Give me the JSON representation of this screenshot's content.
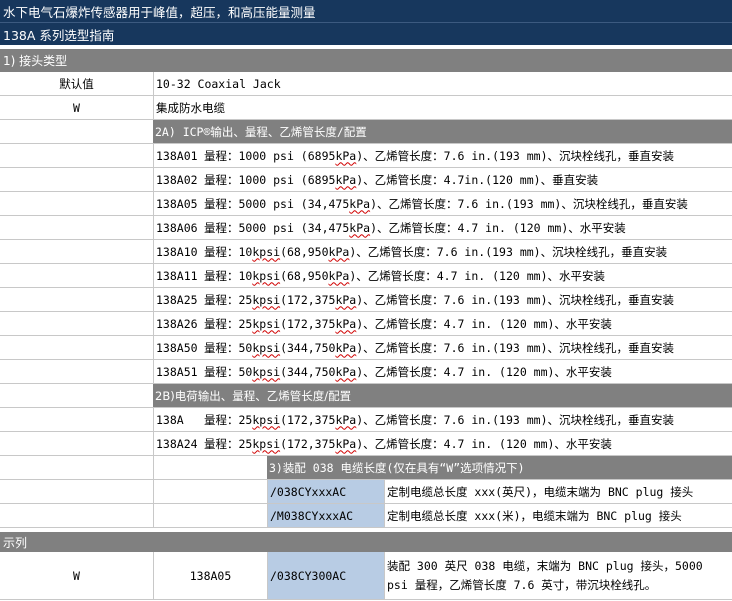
{
  "title": "水下电气石爆炸传感器用于峰值，超压，和高压能量测量",
  "subtitle": "138A 系列选型指南",
  "section1": {
    "header": "1) 接头类型",
    "rows": [
      {
        "code": "默认值",
        "desc": "10-32 Coaxial Jack"
      },
      {
        "code": "W",
        "desc": "集成防水电缆"
      }
    ]
  },
  "section2a": {
    "header": "2A) ICP®输出、量程、乙烯管长度/配置",
    "rows": [
      {
        "model": "138A01",
        "pre": "量程：1000 psi (6895 ",
        "unit": "kPa",
        "post": ")、乙烯管长度：7.6 in.(193 mm)、沉块栓线孔，垂直安装"
      },
      {
        "model": "138A02",
        "pre": "量程：1000 psi (6895 ",
        "unit": "kPa",
        "post": ")、乙烯管长度：4.7in.(120 mm)、垂直安装"
      },
      {
        "model": "138A05",
        "pre": "量程：5000 psi (34,475 ",
        "unit": "kPa",
        "post": ")、乙烯管长度：7.6 in.(193 mm)、沉块栓线孔，垂直安装"
      },
      {
        "model": "138A06",
        "pre": "量程：5000 psi (34,475 ",
        "unit": "kPa",
        "post": ")、乙烯管长度：4.7 in. (120 mm)、水平安装"
      },
      {
        "model": "138A10",
        "pre": "量程：10 ",
        "wavy1": "kpsi",
        "mid": " (68,950 ",
        "unit": "kPa",
        "post": ")、乙烯管长度：7.6 in.(193 mm)、沉块栓线孔，垂直安装"
      },
      {
        "model": "138A11",
        "pre": "量程：10 ",
        "wavy1": "kpsi",
        "mid": " (68,950 ",
        "unit": "kPa",
        "post": ")、乙烯管长度：4.7 in. (120 mm)、水平安装"
      },
      {
        "model": "138A25",
        "pre": "量程：25 ",
        "wavy1": "kpsi",
        "mid": " (172,375 ",
        "unit": "kPa",
        "post": ")、乙烯管长度：7.6 in.(193 mm)、沉块栓线孔，垂直安装"
      },
      {
        "model": "138A26",
        "pre": "量程：25 ",
        "wavy1": "kpsi",
        "mid": " (172,375 ",
        "unit": "kPa",
        "post": ")、乙烯管长度：4.7 in. (120 mm)、水平安装"
      },
      {
        "model": "138A50",
        "pre": "量程：50 ",
        "wavy1": "kpsi",
        "mid": " (344,750 ",
        "unit": "kPa",
        "post": ")、乙烯管长度：7.6 in.(193 mm)、沉块栓线孔，垂直安装"
      },
      {
        "model": "138A51",
        "pre": "量程：50 ",
        "wavy1": "kpsi",
        "mid": " (344,750 ",
        "unit": "kPa",
        "post": ")、乙烯管长度：4.7 in. (120 mm)、水平安装"
      }
    ]
  },
  "section2b": {
    "header": "2B)电荷输出、量程、乙烯管长度/配置",
    "rows": [
      {
        "model": "138A",
        "pre": "量程：25 ",
        "wavy1": "kpsi",
        "mid": " (172,375 ",
        "unit": "kPa",
        "post": ")、乙烯管长度：7.6 in.(193 mm)、沉块栓线孔，垂直安装"
      },
      {
        "model": "138A24",
        "pre": "量程：25 ",
        "wavy1": "kpsi",
        "mid": " (172,375 ",
        "unit": "kPa",
        "post": ")、乙烯管长度：4.7 in. (120 mm)、水平安装"
      }
    ]
  },
  "section3": {
    "header": "3)装配 038 电缆长度(仅在具有“W”选项情况下)",
    "rows": [
      {
        "code": "/038CYxxxAC",
        "desc": "定制电缆总长度 xxx(英尺)，电缆末端为 BNC plug 接头"
      },
      {
        "code": "/M038CYxxxAC",
        "desc": "定制电缆总长度 xxx(米)，电缆末端为 BNC plug 接头"
      }
    ]
  },
  "example": {
    "header": "示列",
    "connector": "W",
    "model": "138A05",
    "cable": "/038CY300AC",
    "desc": "装配 300 英尺 038 电缆，末端为 BNC plug 接头，5000 psi 量程，乙烯管长度 7.6 英寸，带沉块栓线孔。"
  },
  "colors": {
    "title_bg": "#17375d",
    "header_bg": "#808080",
    "code_bg": "#b8cce4",
    "grid": "#c8c8c8",
    "spell_underline": "#d00000"
  }
}
